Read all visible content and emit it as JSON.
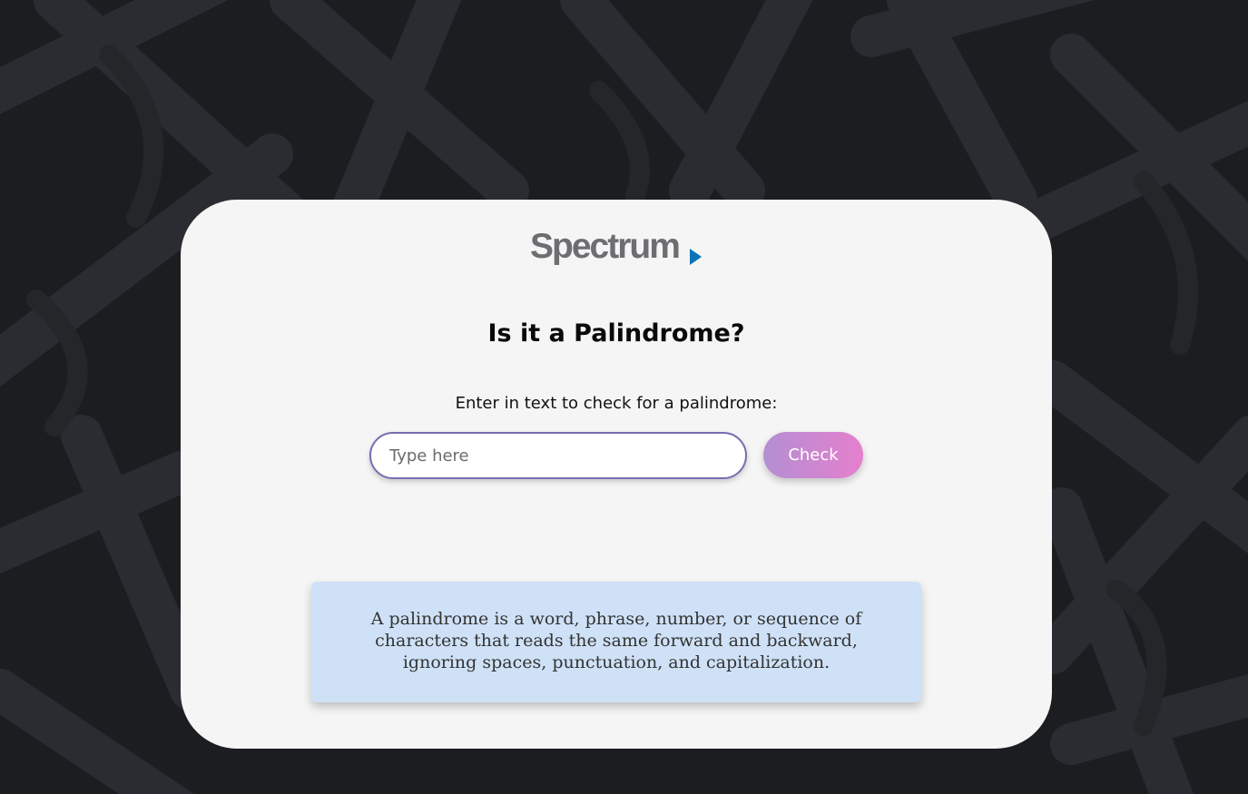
{
  "logo": {
    "text": "Spectrum",
    "arrow_color": "#0b73b8",
    "text_color": "#6d6e71"
  },
  "title": "Is it a Palindrome?",
  "prompt": "Enter in text to check for a palindrome:",
  "input": {
    "placeholder": "Type here",
    "value": ""
  },
  "check_button": {
    "label": "Check"
  },
  "info": {
    "text": "A palindrome is a word, phrase, number, or sequence of characters that reads the same forward and backward, ignoring spaces, punctuation, and capitalization."
  },
  "colors": {
    "background": "#1d1e21",
    "card": "#f5f5f5",
    "info_box": "#cfe1f6",
    "input_border": "#7a6cb0",
    "button_gradient_start": "#b48fd3",
    "button_gradient_end": "#e57fcd"
  }
}
